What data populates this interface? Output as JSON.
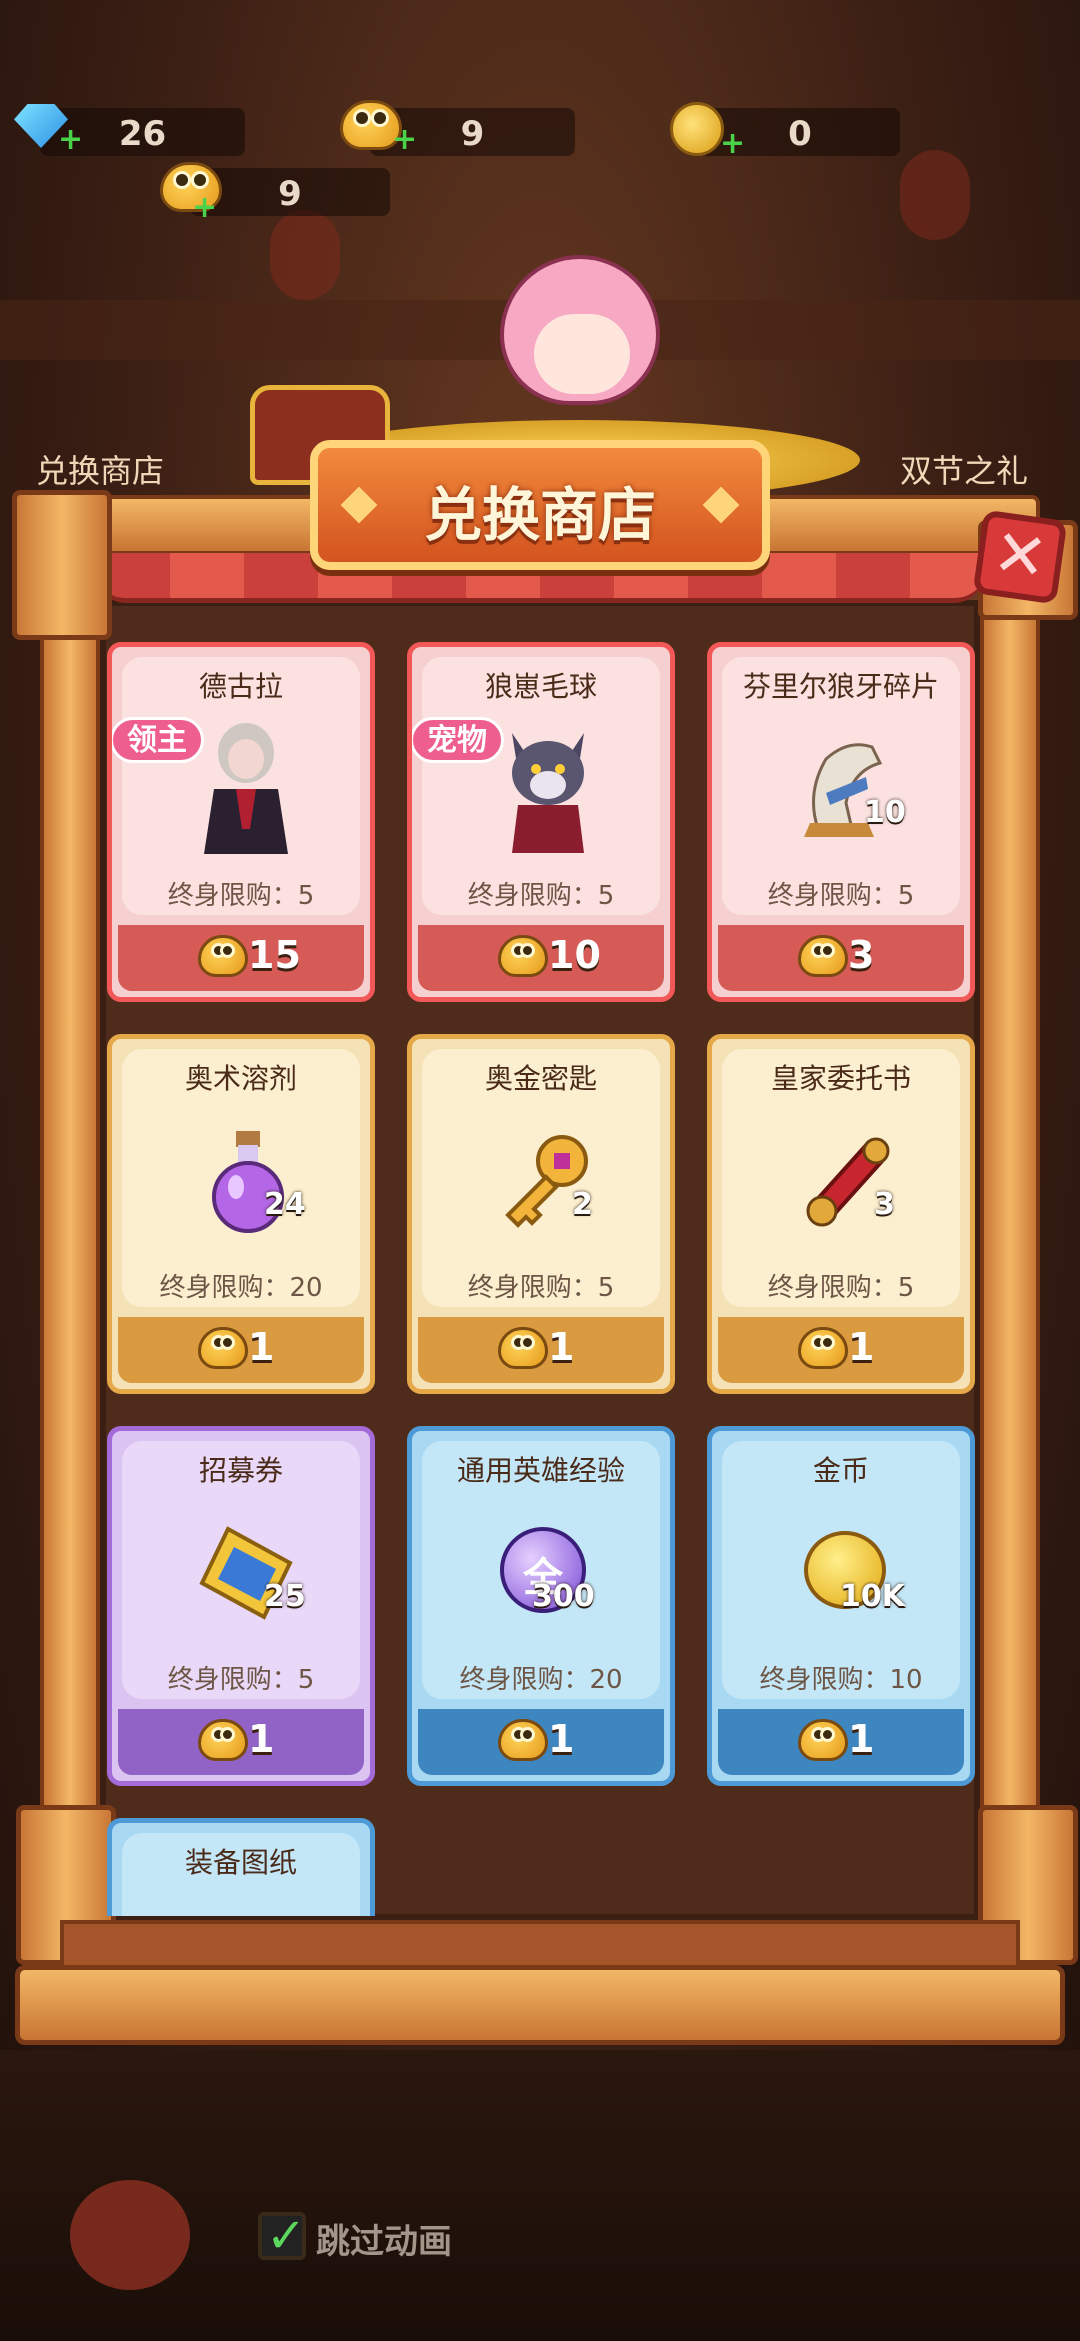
{
  "resources": {
    "gems": "26",
    "toad_top": "9",
    "coins": "0",
    "toad_main": "9"
  },
  "side_buttons": {
    "left_label": "兑换商店",
    "right_label": "双节之礼"
  },
  "shop": {
    "title": "兑换商店",
    "close_symbol": "✕"
  },
  "cards": [
    {
      "name": "德古拉",
      "tag": "领主",
      "limit": "终身限购：5",
      "price": "15",
      "qty": ""
    },
    {
      "name": "狼崽毛球",
      "tag": "宠物",
      "limit": "终身限购：5",
      "price": "10",
      "qty": ""
    },
    {
      "name": "芬里尔狼牙碎片",
      "tag": "",
      "limit": "终身限购：5",
      "price": "3",
      "qty": "10"
    },
    {
      "name": "奥术溶剂",
      "tag": "",
      "limit": "终身限购：20",
      "price": "1",
      "qty": "24"
    },
    {
      "name": "奥金密匙",
      "tag": "",
      "limit": "终身限购：5",
      "price": "1",
      "qty": "2"
    },
    {
      "name": "皇家委托书",
      "tag": "",
      "limit": "终身限购：5",
      "price": "1",
      "qty": "3"
    },
    {
      "name": "招募券",
      "tag": "",
      "limit": "终身限购：5",
      "price": "1",
      "qty": "25"
    },
    {
      "name": "通用英雄经验",
      "tag": "",
      "limit": "终身限购：20",
      "price": "1",
      "qty": "300",
      "icon_text": "全"
    },
    {
      "name": "金币",
      "tag": "",
      "limit": "终身限购：10",
      "price": "1",
      "qty": "10K"
    },
    {
      "name": "装备图纸",
      "tag": "",
      "limit": "",
      "price": "",
      "qty": ""
    }
  ],
  "skip_animation": {
    "label": "跳过动画",
    "checked": true
  },
  "colors": {
    "red_card": "#f25858",
    "yellow_card": "#e5a94a",
    "purple_card": "#a46ad8",
    "blue_card": "#4d9ad6",
    "title_plaque": "#d3541f"
  },
  "icons": [
    "gem-icon",
    "toad-icon",
    "coin-icon",
    "close-icon",
    "dracula-icon",
    "wolf-pup-icon",
    "fang-shard-icon",
    "potion-icon",
    "key-icon",
    "scroll-icon",
    "ticket-icon",
    "exp-orb-icon",
    "gold-coin-icon",
    "checkbox-icon"
  ]
}
